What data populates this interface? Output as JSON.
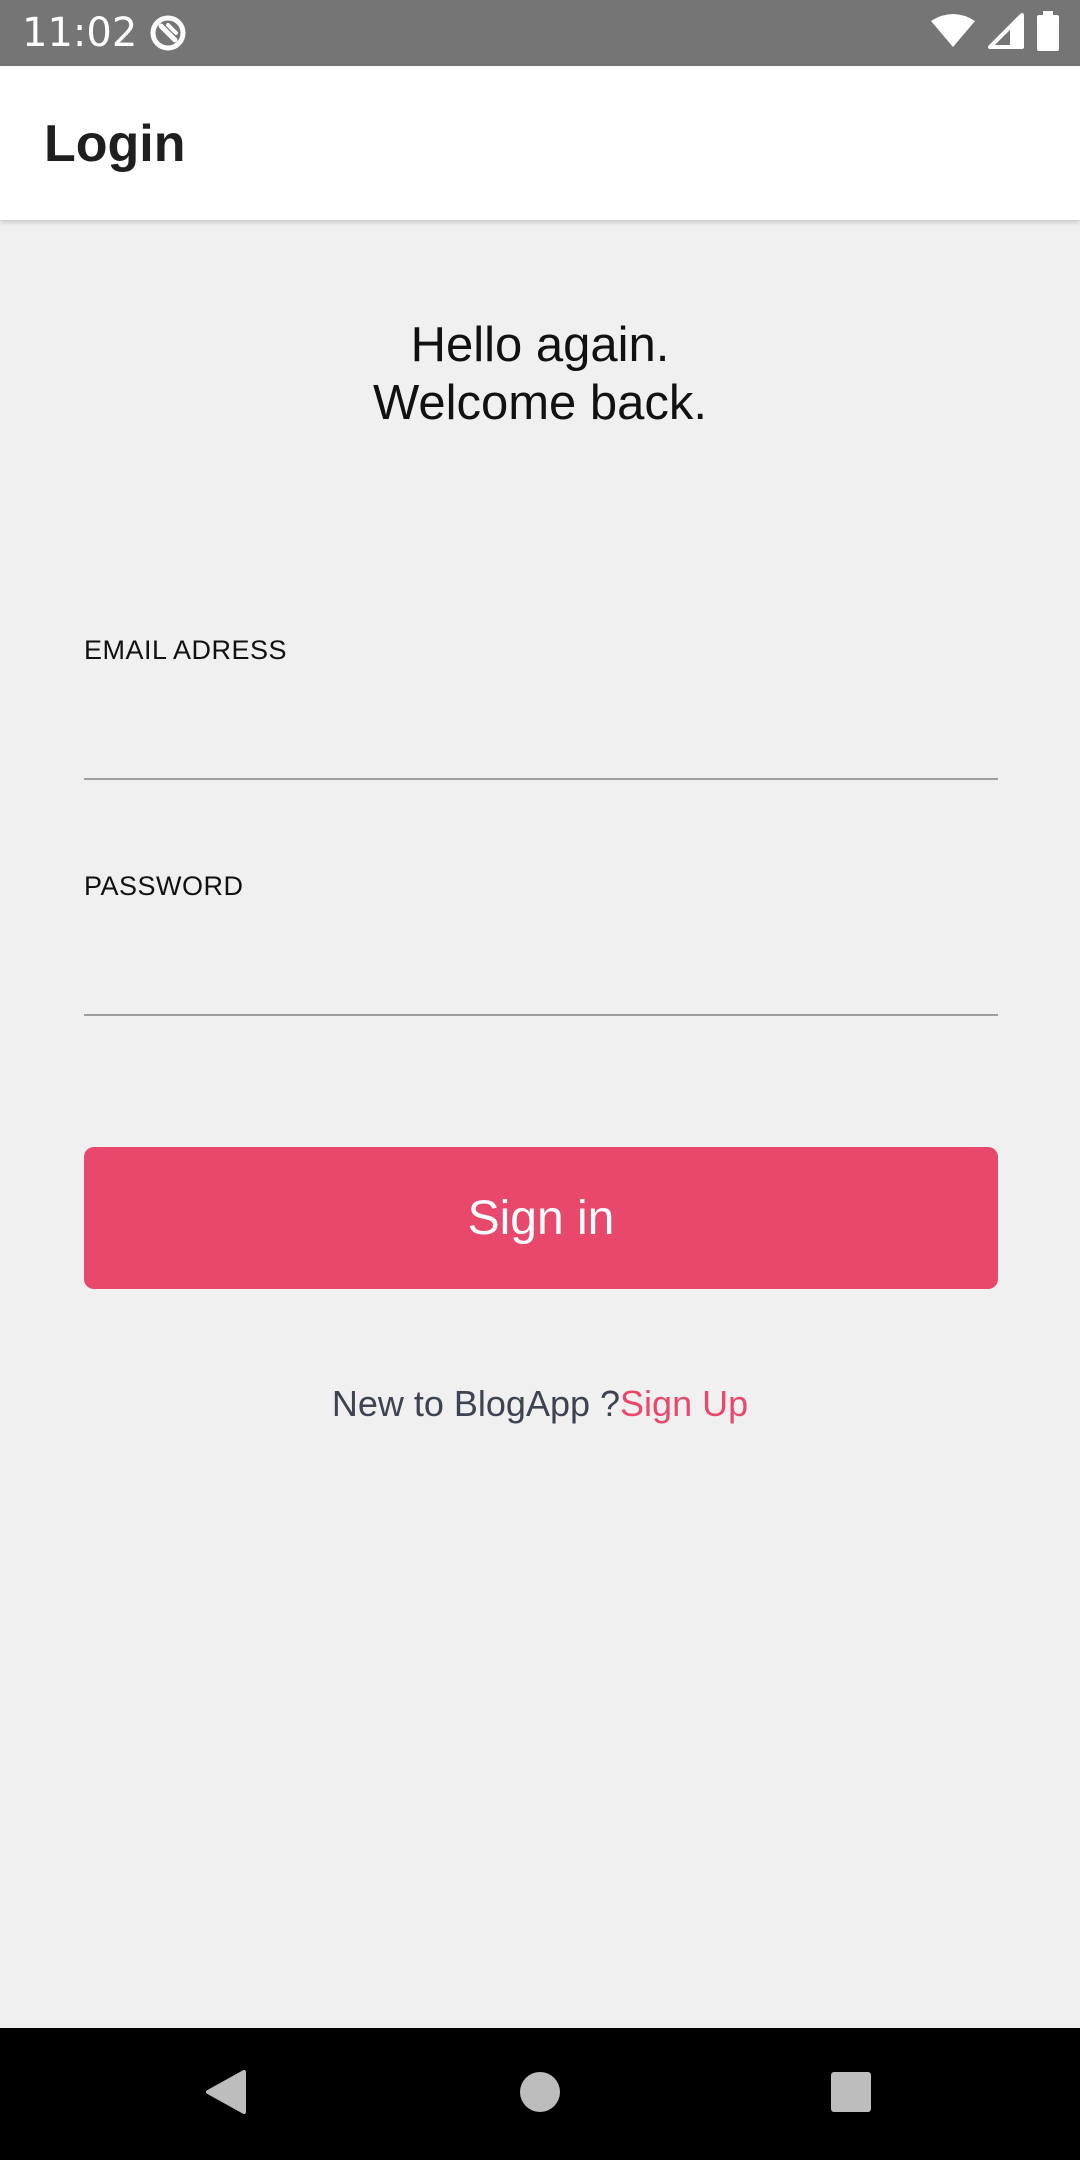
{
  "status_bar": {
    "time": "11:02",
    "background_color": "#757575",
    "icons": [
      "app-notification-icon",
      "wifi-icon",
      "cell-signal-icon",
      "battery-icon"
    ]
  },
  "app_bar": {
    "title": "Login"
  },
  "greeting": {
    "line1": "Hello again.",
    "line2": "Welcome back."
  },
  "form": {
    "email_label": "EMAIL ADRESS",
    "email_value": "",
    "password_label": "PASSWORD",
    "password_value": "",
    "sign_in_label": "Sign in"
  },
  "signup": {
    "prompt": "New to BlogApp ?",
    "link": "Sign Up"
  },
  "nav_bar": {
    "icons": [
      "back-icon",
      "home-icon",
      "recents-icon"
    ]
  },
  "colors": {
    "accent": "#e8486b",
    "background": "#f0f0f0",
    "app_bar": "#ffffff",
    "nav_bar": "#000000",
    "secondary_text": "#3d4451"
  }
}
